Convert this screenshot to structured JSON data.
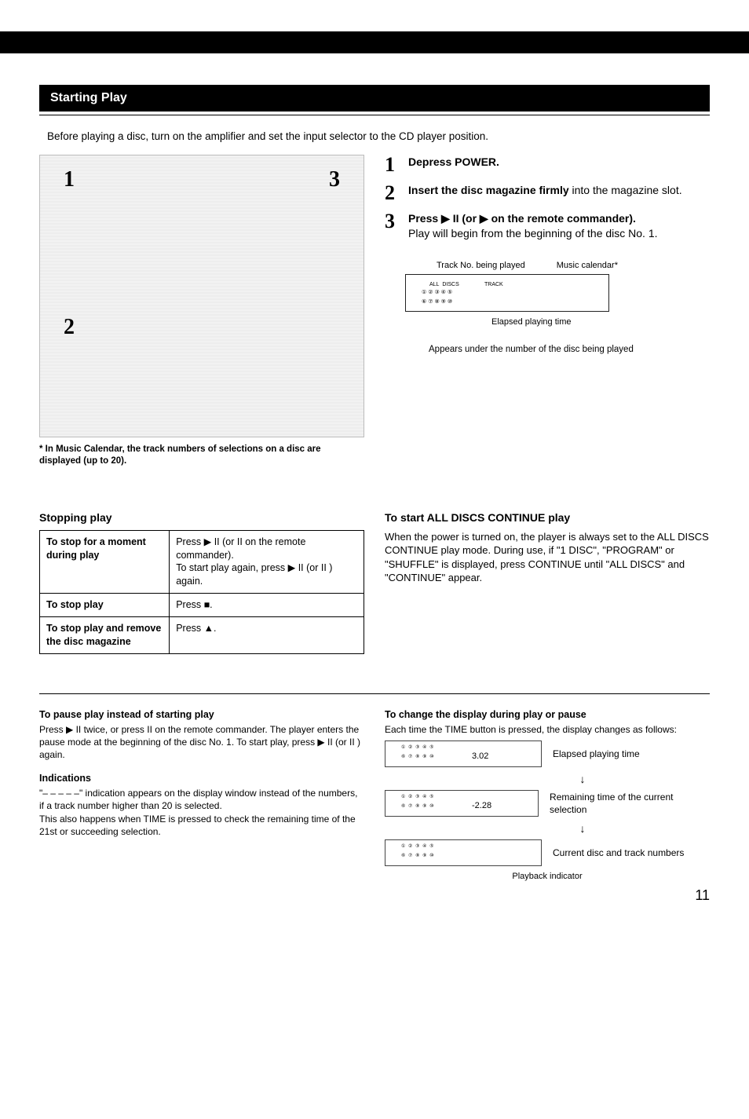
{
  "section_title": "Starting Play",
  "intro": "Before playing a disc, turn on the amplifier and set the input selector to the CD player position.",
  "diagram_numbers": {
    "n1": "1",
    "n2": "2",
    "n3": "3"
  },
  "footnote": "* In Music Calendar, the track numbers of selections on a disc are displayed (up to 20).",
  "steps": {
    "s1": {
      "num": "1",
      "bold": "Depress POWER."
    },
    "s2": {
      "num": "2",
      "bold": "Insert the disc magazine firmly",
      "rest": " into the magazine slot."
    },
    "s3": {
      "num": "3",
      "bold": "Press ▶ II (or ▶ on the remote commander).",
      "rest": "Play will begin from the beginning of the disc No. 1."
    }
  },
  "display": {
    "track_label": "Track No. being played",
    "music_cal": "Music calendar*",
    "elapsed": "Elapsed playing time",
    "appears": "Appears under the number of the disc being played"
  },
  "stopping": {
    "heading": "Stopping play",
    "rows": [
      {
        "label": "To stop for a moment during play",
        "value": "Press ▶ II (or II on the remote commander).\nTo start play again, press ▶ II (or II ) again."
      },
      {
        "label": "To stop play",
        "value": "Press ■."
      },
      {
        "label": "To stop play and remove the disc magazine",
        "value": "Press ▲."
      }
    ]
  },
  "all_discs": {
    "heading": "To start ALL DISCS CONTINUE play",
    "body": "When the power is turned on, the player is always set to the ALL DISCS CONTINUE play mode. During use, if \"1 DISC\", \"PROGRAM\" or \"SHUFFLE\" is displayed, press CONTINUE until \"ALL DISCS\" and \"CONTINUE\" appear."
  },
  "pause": {
    "heading": "To pause play instead of starting play",
    "body": "Press ▶ II twice, or press II on the remote commander. The player enters the pause mode at the beginning of the disc No. 1. To start play, press ▶ II (or II ) again."
  },
  "indications": {
    "heading": "Indications",
    "body": "\"– – – – –\" indication appears on the display window instead of the numbers, if a track number higher than 20 is selected.\nThis also happens when TIME is pressed to check the remaining time of the 21st or succeeding selection."
  },
  "change_display": {
    "heading": "To change the display during play or pause",
    "intro": "Each time the TIME button is pressed, the display changes as follows:",
    "rows": [
      {
        "val": "3.02",
        "caption": "Elapsed playing time"
      },
      {
        "val": "-2.28",
        "caption": "Remaining time of the current selection"
      },
      {
        "val": "",
        "caption": "Current disc and track numbers"
      }
    ],
    "playback_indicator": "Playback indicator"
  },
  "page_number": "11"
}
